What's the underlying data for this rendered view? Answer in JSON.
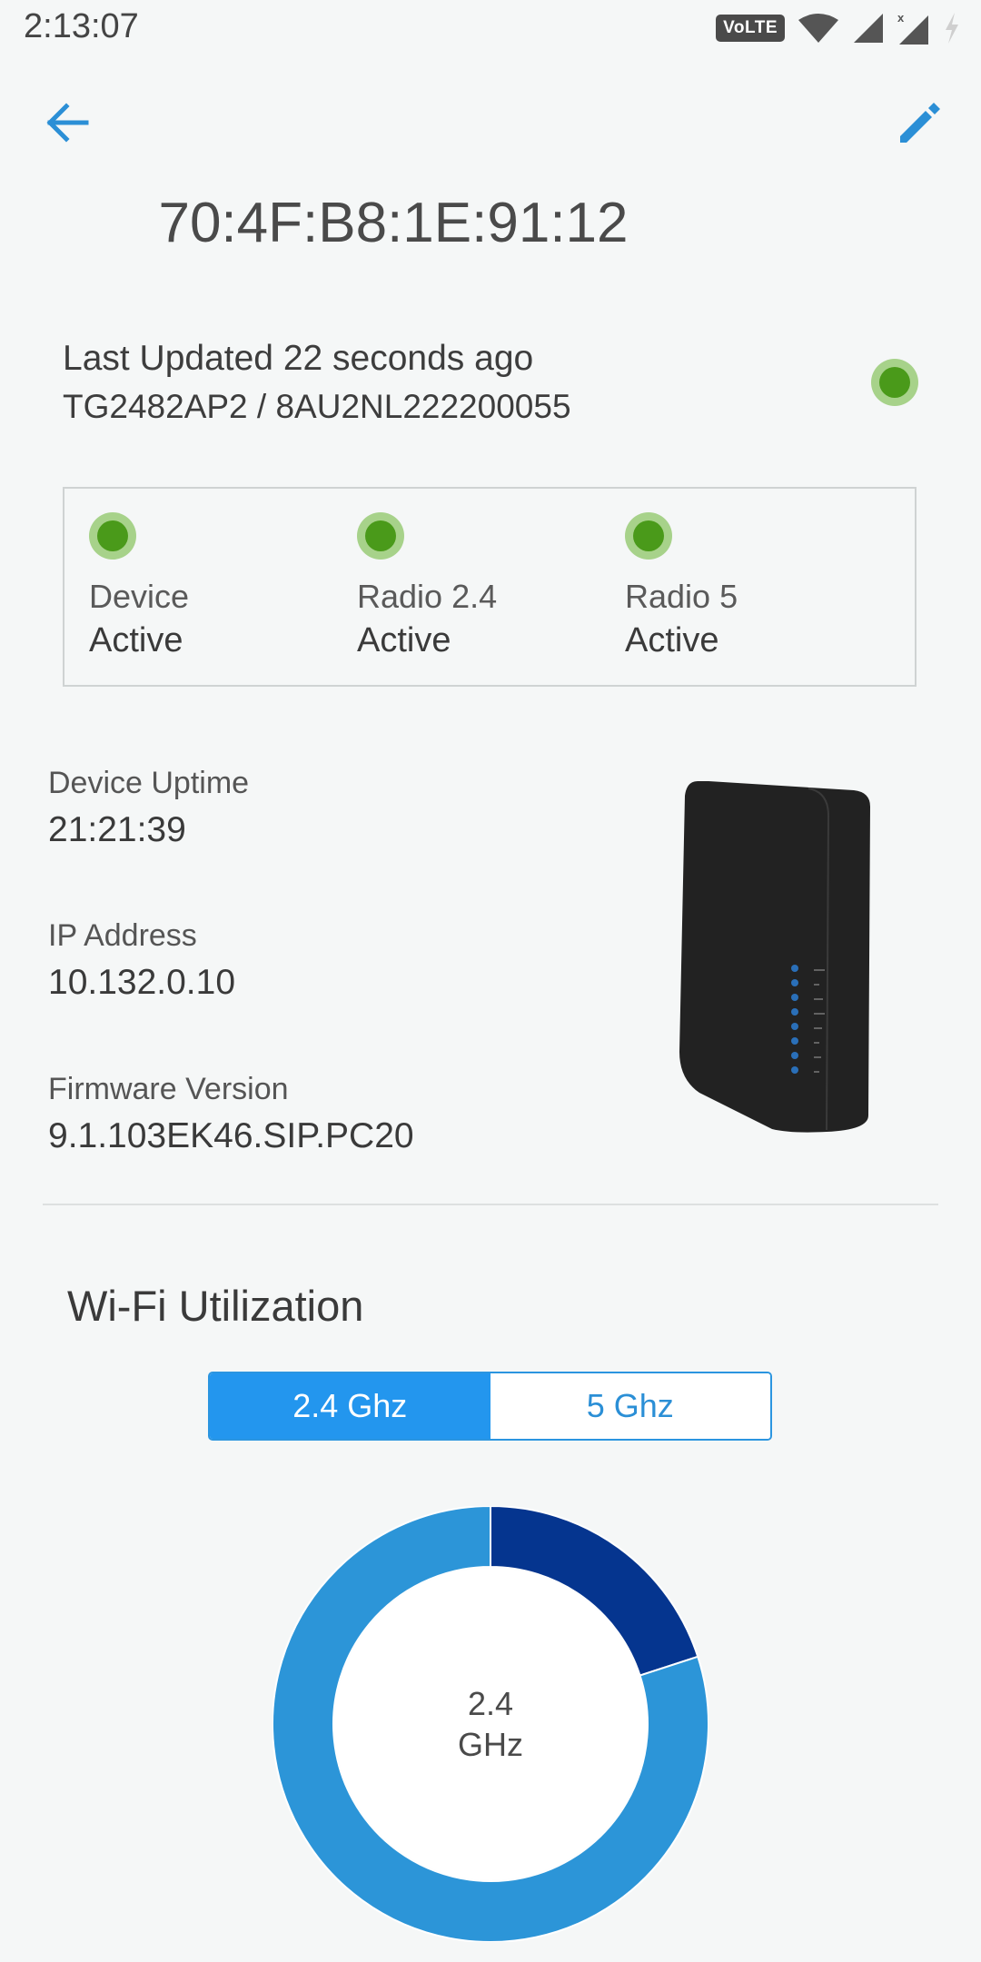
{
  "status_bar": {
    "time": "2:13:07",
    "volte": "VoLTE",
    "icons": [
      "volte-icon",
      "wifi-icon",
      "signal-icon",
      "signal-x-icon",
      "charging-icon"
    ]
  },
  "header": {
    "back_icon": "arrow-left-icon",
    "edit_icon": "pencil-icon",
    "title": "70:4F:B8:1E:91:12"
  },
  "summary": {
    "last_updated": "Last Updated 22 seconds ago",
    "model_serial": "TG2482AP2 / 8AU2NL222200055",
    "overall_status_color": "#4a9a1a"
  },
  "status_box": {
    "items": [
      {
        "label": "Device",
        "value": "Active"
      },
      {
        "label": "Radio 2.4",
        "value": "Active"
      },
      {
        "label": "Radio 5",
        "value": "Active"
      }
    ]
  },
  "info": {
    "uptime_label": "Device Uptime",
    "uptime_value": "21:21:39",
    "ip_label": "IP Address",
    "ip_value": "10.132.0.10",
    "firmware_label": "Firmware Version",
    "firmware_value": "9.1.103EK46.SIP.PC20"
  },
  "wifi": {
    "title": "Wi-Fi Utilization",
    "tabs": [
      {
        "label": "2.4 Ghz",
        "active": true
      },
      {
        "label": "5 Ghz",
        "active": false
      }
    ],
    "center_line1": "2.4",
    "center_line2": "GHz"
  },
  "colors": {
    "accent": "#2396ee",
    "donut_dark": "#05358f",
    "donut_light": "#2c95d8",
    "active_green": "#4a9a1a"
  },
  "chart_data": {
    "type": "pie",
    "values": [
      20,
      80
    ],
    "colors": [
      "#05358f",
      "#2c95d8"
    ]
  }
}
